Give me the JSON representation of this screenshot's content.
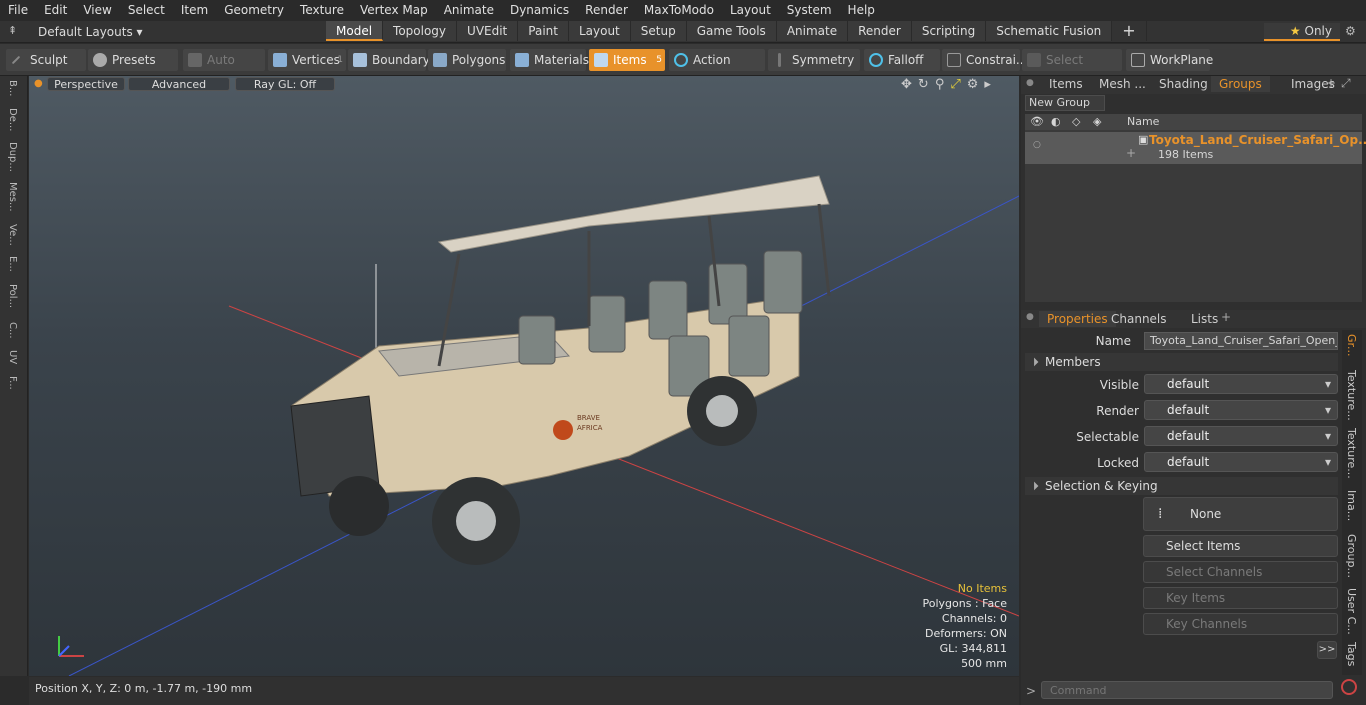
{
  "menu": [
    "File",
    "Edit",
    "View",
    "Select",
    "Item",
    "Geometry",
    "Texture",
    "Vertex Map",
    "Animate",
    "Dynamics",
    "Render",
    "MaxToModo",
    "Layout",
    "System",
    "Help"
  ],
  "layout_selector": "Default Layouts ▾",
  "tabs": [
    "Model",
    "Topology",
    "UVEdit",
    "Paint",
    "Layout",
    "Setup",
    "Game Tools",
    "Animate",
    "Render",
    "Scripting",
    "Schematic Fusion"
  ],
  "add_tab": "+",
  "only_label": "Only",
  "toolbar": {
    "sculpt": "Sculpt",
    "presets": "Presets",
    "auto_select": "Auto Select",
    "vertices": "Vertices",
    "vertices_count": "1",
    "boundary": "Boundary",
    "polygons": "Polygons",
    "materials": "Materials",
    "items": "Items",
    "items_count": "5",
    "action_center": "Action Center",
    "symmetry": "Symmetry",
    "falloff": "Falloff",
    "constraints": "Constrai...",
    "select_through": "Select Through",
    "workplane": "WorkPlane"
  },
  "left_strip": [
    "B...",
    "De...",
    "Dup...",
    "Mes...",
    "Ve...",
    "E...",
    "Pol...",
    "C...",
    "UV",
    "F..."
  ],
  "viewport": {
    "perspective": "Perspective",
    "advanced": "Advanced",
    "raygl": "Ray GL: Off",
    "stats": {
      "no_items": "No Items",
      "polygons": "Polygons : Face",
      "channels": "Channels: 0",
      "deformers": "Deformers: ON",
      "gl": "GL: 344,811",
      "scale": "500 mm"
    },
    "decal_line1": "BRAVE",
    "decal_line2": "AFRICA"
  },
  "status": "Position X, Y, Z:   0 m, -1.77 m, -190 mm",
  "right_tabs": [
    "Items",
    "Mesh ...",
    "Shading",
    "Groups",
    "Images"
  ],
  "new_group": "New Group",
  "list_header": "Name",
  "group": {
    "name": "Toyota_Land_Cruiser_Safari_Op...",
    "count": "198 Items"
  },
  "prop_tabs": [
    "Properties",
    "Channels",
    "Lists"
  ],
  "props": {
    "name_label": "Name",
    "name_value": "Toyota_Land_Cruiser_Safari_Open_Si",
    "members": "Members",
    "visible_label": "Visible",
    "visible": "default",
    "render_label": "Render",
    "render": "default",
    "selectable_label": "Selectable",
    "selectable": "default",
    "locked_label": "Locked",
    "locked": "default",
    "sel_keying": "Selection & Keying",
    "none": "None",
    "select_items": "Select Items",
    "select_channels": "Select Channels",
    "key_items": "Key Items",
    "key_channels": "Key Channels",
    "more": ">>"
  },
  "side_tabs": [
    "Gr...",
    "Texture...",
    "Texture...",
    "Ima...",
    "Group...",
    "User C...",
    "Tags"
  ],
  "command_placeholder": "Command",
  "colors": {
    "accent": "#e8922a",
    "viewport_top": "#4f5a63",
    "viewport_bottom": "#2e353b"
  }
}
